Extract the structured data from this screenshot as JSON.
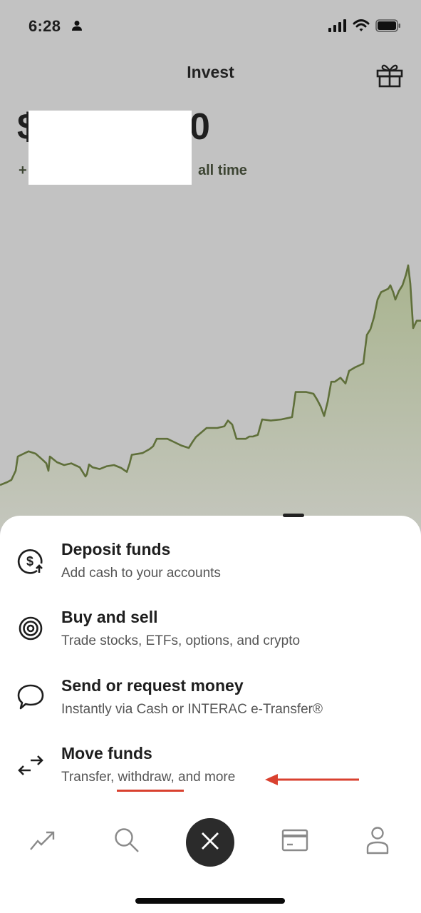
{
  "status_bar": {
    "time": "6:28",
    "icons": [
      "person-icon",
      "signal-icon",
      "wifi-icon",
      "battery-icon"
    ]
  },
  "header": {
    "title": "Invest",
    "right_icon": "gift-icon"
  },
  "portfolio": {
    "balance_visible_prefix": "$",
    "balance_visible_suffix": "0",
    "gain_visible_prefix": "+",
    "gain_period": "all time",
    "redacted": true
  },
  "colors": {
    "background": "#c2c2c2",
    "chart_line": "#5f6f3a",
    "chart_fill_top": "#a9b48f",
    "chart_fill_bottom": "#c4c6bd",
    "sheet": "#ffffff",
    "annotation": "#d9412f",
    "fab": "#2b2b2b"
  },
  "chart_data": {
    "type": "area",
    "title": "",
    "xlabel": "",
    "ylabel": "",
    "note": "No axes shown; values are a relative index (start = 100) estimated from line shape",
    "x": [
      0,
      10,
      16,
      22,
      25,
      40,
      50,
      60,
      65,
      68,
      70,
      80,
      90,
      100,
      112,
      120,
      122,
      125,
      130,
      140,
      150,
      160,
      170,
      178,
      182,
      185,
      200,
      210,
      215,
      220,
      235,
      245,
      255,
      265,
      270,
      275,
      290,
      305,
      315,
      320,
      326,
      332,
      345,
      350,
      355,
      362,
      368,
      380,
      395,
      410,
      415,
      430,
      440,
      445,
      450,
      455,
      460,
      465,
      470,
      478,
      485,
      490,
      498,
      505,
      510,
      515,
      520,
      525,
      530,
      535,
      545,
      548,
      552,
      555,
      560,
      565,
      570,
      573,
      576,
      580,
      585,
      591
    ],
    "values": [
      100,
      105,
      109,
      125,
      150,
      159,
      155,
      144,
      138,
      125,
      150,
      140,
      135,
      138,
      131,
      115,
      119,
      136,
      131,
      128,
      133,
      135,
      130,
      123,
      138,
      153,
      156,
      163,
      168,
      181,
      181,
      175,
      169,
      165,
      175,
      184,
      200,
      200,
      203,
      213,
      206,
      181,
      181,
      185,
      185,
      188,
      215,
      213,
      215,
      219,
      263,
      263,
      260,
      250,
      238,
      221,
      246,
      281,
      281,
      288,
      278,
      300,
      306,
      310,
      313,
      363,
      373,
      394,
      425,
      438,
      444,
      450,
      438,
      425,
      440,
      450,
      469,
      485,
      453,
      375,
      388,
      388
    ],
    "ylim": [
      0,
      500
    ],
    "grid": false,
    "legend": "none"
  },
  "action_sheet": {
    "items": [
      {
        "icon": "dollar-deposit-icon",
        "title": "Deposit funds",
        "subtitle": "Add cash to your accounts"
      },
      {
        "icon": "target-icon",
        "title": "Buy and sell",
        "subtitle": "Trade stocks, ETFs, options, and crypto"
      },
      {
        "icon": "chat-bubble-icon",
        "title": "Send or request money",
        "subtitle": "Instantly via Cash or INTERAC e-Transfer®"
      },
      {
        "icon": "transfer-arrows-icon",
        "title": "Move funds",
        "subtitle": "Transfer, withdraw, and more"
      }
    ]
  },
  "annotation": {
    "underlined_word": "withdraw",
    "arrow_pointing": "left"
  },
  "tab_bar": {
    "items": [
      {
        "icon": "trend-up-icon",
        "name": "invest"
      },
      {
        "icon": "search-icon",
        "name": "search"
      },
      {
        "icon": "close-icon",
        "name": "close-actions"
      },
      {
        "icon": "card-icon",
        "name": "card"
      },
      {
        "icon": "profile-icon",
        "name": "profile"
      }
    ]
  }
}
